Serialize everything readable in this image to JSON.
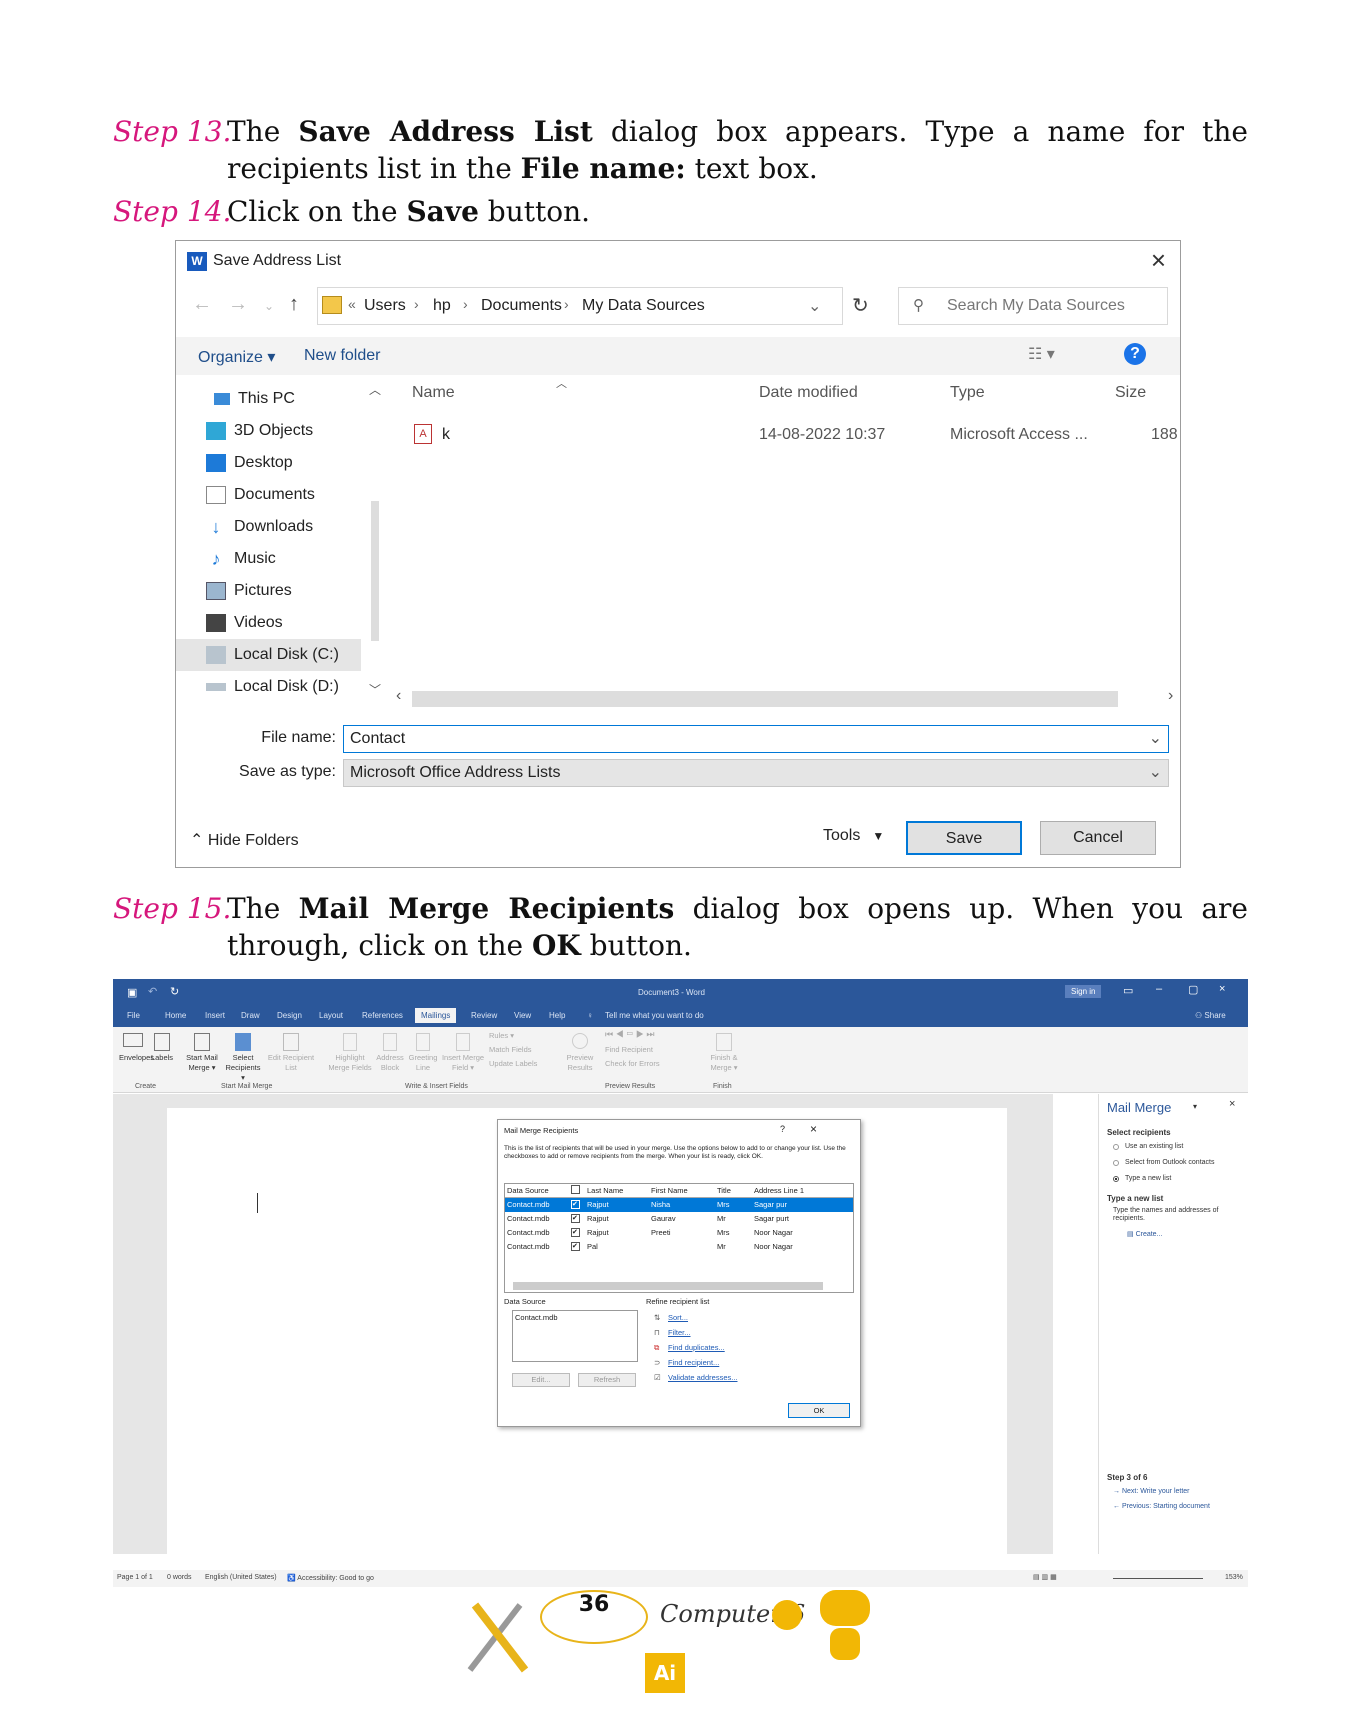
{
  "steps": [
    {
      "label": "Step 13.",
      "pre": "The ",
      "b1": "Save Address List",
      "mid": " dialog box appears. Type a name for the recipients list in the ",
      "b2": "File name:",
      "post": " text box."
    },
    {
      "label": "Step 14.",
      "pre": "Click on the ",
      "b1": "Save",
      "post": " button."
    },
    {
      "label": "Step 15.",
      "pre": "The ",
      "b1": "Mail Merge Recipients",
      "mid": " dialog box opens up. When you are through, click on the ",
      "b2": "OK",
      "post": " button."
    }
  ],
  "save_dialog": {
    "title": "Save Address List",
    "app_icon": "W",
    "breadcrumb": [
      "Users",
      "hp",
      "Documents",
      "My Data Sources"
    ],
    "search_placeholder": "Search My Data Sources",
    "organize": "Organize ▾",
    "new_folder": "New folder",
    "nav_items": [
      "This PC",
      "3D Objects",
      "Desktop",
      "Documents",
      "Downloads",
      "Music",
      "Pictures",
      "Videos",
      "Local Disk (C:)",
      "Local Disk (D:)"
    ],
    "columns": [
      "Name",
      "Date modified",
      "Type",
      "Size"
    ],
    "file": {
      "name": "k",
      "date": "14-08-2022 10:37",
      "type": "Microsoft Access ...",
      "size": "188"
    },
    "file_name_label": "File name:",
    "file_name_value": "Contact",
    "save_type_label": "Save as type:",
    "save_type_value": "Microsoft Office Address Lists",
    "hide_folders": "Hide Folders",
    "tools": "Tools",
    "save": "Save",
    "cancel": "Cancel"
  },
  "word": {
    "title": "Document3 - Word",
    "sign_in": "Sign in",
    "share": "Share",
    "tabs": [
      "File",
      "Home",
      "Insert",
      "Draw",
      "Design",
      "Layout",
      "References",
      "Mailings",
      "Review",
      "View",
      "Help"
    ],
    "tell_me": "Tell me what you want to do",
    "ribbon": {
      "envelopes": "Envelopes",
      "labels": "Labels",
      "start_mail_merge": "Start Mail Merge ▾",
      "select_recipients": "Select Recipients ▾",
      "edit_recipient_list": "Edit Recipient List",
      "highlight": "Highlight Merge Fields",
      "address_block": "Address Block",
      "greeting_line": "Greeting Line",
      "insert_merge_field": "Insert Merge Field ▾",
      "rules": "Rules ▾",
      "match_fields": "Match Fields",
      "update_labels": "Update Labels",
      "preview_results": "Preview Results",
      "find_recipient": "Find Recipient",
      "check_errors": "Check for Errors",
      "finish_merge": "Finish & Merge ▾",
      "groups": [
        "Create",
        "Start Mail Merge",
        "Write & Insert Fields",
        "Preview Results",
        "Finish"
      ]
    },
    "mm_pane": {
      "title": "Mail Merge",
      "select_recipients": "Select recipients",
      "opt1": "Use an existing list",
      "opt2": "Select from Outlook contacts",
      "opt3": "Type a new list",
      "type_new_list": "Type a new list",
      "desc": "Type the names and addresses of recipients.",
      "create": "Create...",
      "step": "Step 3 of 6",
      "next": "Next: Write your letter",
      "prev": "Previous: Starting document"
    },
    "status": {
      "page": "Page 1 of 1",
      "words": "0 words",
      "lang": "English (United States)",
      "access": "Accessibility: Good to go",
      "zoom": "153%"
    },
    "mmr": {
      "title": "Mail Merge Recipients",
      "desc": "This is the list of recipients that will be used in your merge. Use the options below to add to or change your list. Use the checkboxes to add or remove recipients from the merge. When your list is ready, click OK.",
      "headers": [
        "Data Source",
        "Last Name",
        "First Name",
        "Title",
        "Address Line 1"
      ],
      "rows": [
        [
          "Contact.mdb",
          "Rajput",
          "Nisha",
          "Mrs",
          "Sagar pur"
        ],
        [
          "Contact.mdb",
          "Rajput",
          "Gaurav",
          "Mr",
          "Sagar purt"
        ],
        [
          "Contact.mdb",
          "Rajput",
          "Preeti",
          "Mrs",
          "Noor Nagar"
        ],
        [
          "Contact.mdb",
          "Pal",
          "",
          "Mr",
          "Noor Nagar"
        ]
      ],
      "data_source_label": "Data Source",
      "data_source_item": "Contact.mdb",
      "edit": "Edit...",
      "refresh": "Refresh",
      "refine_label": "Refine recipient list",
      "refine": [
        "Sort...",
        "Filter...",
        "Find duplicates...",
        "Find recipient...",
        "Validate addresses..."
      ],
      "ok": "OK"
    }
  },
  "footer": {
    "page_number": "36",
    "book": "Computer-6",
    "ai": "Ai"
  },
  "colors": {
    "step_label": "#d6177c",
    "word_blue": "#2b579a",
    "accent": "#0078d7"
  }
}
